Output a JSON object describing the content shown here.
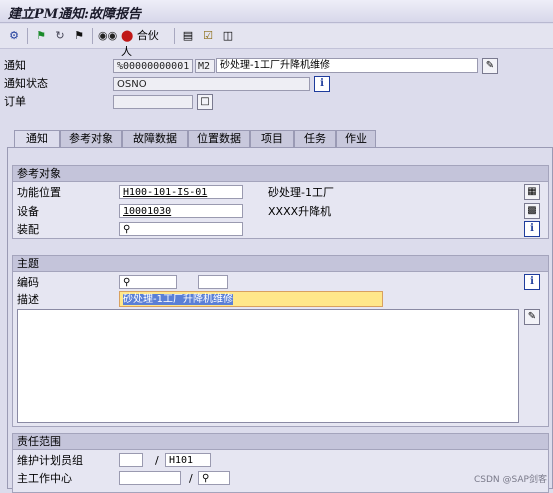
{
  "window": {
    "title": "建立PM通知:故障报告"
  },
  "toolbar": {
    "partner_label": "合伙人",
    "icons": [
      "overview-icon",
      "flag-green-icon",
      "refresh-icon",
      "flag-black-icon",
      "binoculars-icon",
      "partner-icon",
      "notes-icon",
      "approve-icon",
      "export-icon"
    ]
  },
  "header": {
    "notification_label": "通知",
    "notification_number": "%00000000001",
    "notification_type": "M2",
    "notification_text": "砂处理-1工厂升降机维修",
    "status_label": "通知状态",
    "status_value": "OSNO",
    "order_label": "订单",
    "order_value": ""
  },
  "tabs": [
    {
      "label": "通知",
      "active": true
    },
    {
      "label": "参考对象"
    },
    {
      "label": "故障数据"
    },
    {
      "label": "位置数据"
    },
    {
      "label": "项目"
    },
    {
      "label": "任务"
    },
    {
      "label": "作业"
    }
  ],
  "reference": {
    "title": "参考对象",
    "func_loc_label": "功能位置",
    "func_loc_value": "H100-101-IS-01",
    "func_loc_desc": "砂处理-1工厂",
    "equipment_label": "设备",
    "equipment_value": "10001030",
    "equipment_desc": "XXXX升降机",
    "assembly_label": "装配",
    "assembly_value": ""
  },
  "subject": {
    "title": "主题",
    "code_label": "编码",
    "desc_label": "描述",
    "desc_value": "砂处理-1工厂升降机维修"
  },
  "responsibility": {
    "title": "责任范围",
    "planner_group_label": "维护计划员组",
    "planner_group_value": "",
    "planner_plant": "H101",
    "main_wc_label": "主工作中心",
    "main_wc_value": ""
  },
  "watermark": "CSDN @SAP剑客"
}
